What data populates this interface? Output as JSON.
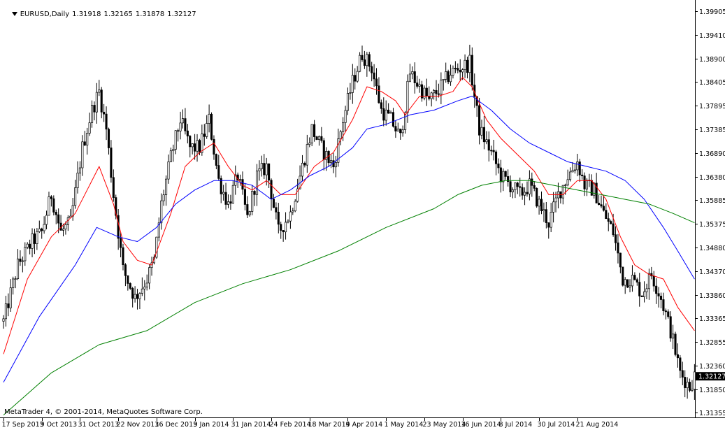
{
  "header": {
    "symbol": "EURUSD,Daily",
    "open": "1.31918",
    "high": "1.32165",
    "low": "1.31878",
    "close": "1.32127"
  },
  "copyright": "MetaTrader 4, © 2001-2014, MetaQuotes Software Corp.",
  "colors": {
    "background": "#ffffff",
    "candle": "#000000",
    "ma_short": "#ff0000",
    "ma_mid": "#0000ff",
    "ma_long": "#008000",
    "price_tag_bg": "#000000",
    "price_tag_fg": "#ffffff"
  },
  "chart_data": {
    "type": "candlestick",
    "symbol": "EURUSD",
    "timeframe": "Daily",
    "ylim": [
      1.3125,
      1.4015
    ],
    "y_ticks": [
      "1.39905",
      "1.39410",
      "1.38900",
      "1.38405",
      "1.37895",
      "1.37385",
      "1.36890",
      "1.36380",
      "1.35885",
      "1.35375",
      "1.34880",
      "1.34370",
      "1.33860",
      "1.33365",
      "1.32855",
      "1.32360",
      "1.31850",
      "1.31355"
    ],
    "current_price": "1.32127",
    "x_tick_labels": [
      "17 Sep 2013",
      "9 Oct 2013",
      "31 Oct 2013",
      "22 Nov 2013",
      "16 Dec 2013",
      "9 Jan 2014",
      "31 Jan 2014",
      "24 Feb 2014",
      "18 Mar 2014",
      "9 Apr 2014",
      "1 May 2014",
      "23 May 2014",
      "16 Jun 2014",
      "8 Jul 2014",
      "30 Jul 2014",
      "21 Aug 2014"
    ],
    "candles_per_label": 16,
    "close_path": [
      [
        0,
        1.333
      ],
      [
        6,
        1.345
      ],
      [
        12,
        1.35
      ],
      [
        16,
        1.352
      ],
      [
        20,
        1.36
      ],
      [
        24,
        1.352
      ],
      [
        28,
        1.354
      ],
      [
        33,
        1.37
      ],
      [
        37,
        1.378
      ],
      [
        40,
        1.382
      ],
      [
        43,
        1.374
      ],
      [
        46,
        1.36
      ],
      [
        50,
        1.344
      ],
      [
        55,
        1.338
      ],
      [
        60,
        1.342
      ],
      [
        63,
        1.346
      ],
      [
        66,
        1.358
      ],
      [
        70,
        1.368
      ],
      [
        74,
        1.376
      ],
      [
        78,
        1.37
      ],
      [
        82,
        1.37
      ],
      [
        86,
        1.376
      ],
      [
        90,
        1.363
      ],
      [
        94,
        1.358
      ],
      [
        98,
        1.364
      ],
      [
        102,
        1.355
      ],
      [
        106,
        1.364
      ],
      [
        110,
        1.366
      ],
      [
        115,
        1.352
      ],
      [
        120,
        1.356
      ],
      [
        124,
        1.364
      ],
      [
        129,
        1.374
      ],
      [
        134,
        1.369
      ],
      [
        138,
        1.366
      ],
      [
        142,
        1.376
      ],
      [
        146,
        1.384
      ],
      [
        150,
        1.39
      ],
      [
        154,
        1.387
      ],
      [
        158,
        1.378
      ],
      [
        162,
        1.376
      ],
      [
        166,
        1.372
      ],
      [
        170,
        1.386
      ],
      [
        174,
        1.383
      ],
      [
        178,
        1.38
      ],
      [
        183,
        1.383
      ],
      [
        187,
        1.386
      ],
      [
        191,
        1.387
      ],
      [
        195,
        1.388
      ],
      [
        199,
        1.374
      ],
      [
        204,
        1.369
      ],
      [
        208,
        1.364
      ],
      [
        212,
        1.362
      ],
      [
        216,
        1.36
      ],
      [
        220,
        1.362
      ],
      [
        224,
        1.358
      ],
      [
        228,
        1.354
      ],
      [
        232,
        1.36
      ],
      [
        236,
        1.364
      ],
      [
        240,
        1.367
      ],
      [
        243,
        1.362
      ],
      [
        247,
        1.361
      ],
      [
        251,
        1.356
      ],
      [
        255,
        1.352
      ],
      [
        259,
        1.342
      ],
      [
        263,
        1.342
      ],
      [
        267,
        1.339
      ],
      [
        271,
        1.343
      ],
      [
        275,
        1.338
      ],
      [
        279,
        1.331
      ],
      [
        283,
        1.322
      ],
      [
        287,
        1.319
      ],
      [
        289,
        1.3213
      ]
    ],
    "moving_averages": [
      {
        "color": "#ff0000",
        "points": [
          [
            0,
            1.326
          ],
          [
            10,
            1.342
          ],
          [
            20,
            1.351
          ],
          [
            30,
            1.356
          ],
          [
            40,
            1.366
          ],
          [
            46,
            1.358
          ],
          [
            50,
            1.35
          ],
          [
            56,
            1.346
          ],
          [
            62,
            1.345
          ],
          [
            70,
            1.356
          ],
          [
            76,
            1.366
          ],
          [
            82,
            1.369
          ],
          [
            88,
            1.371
          ],
          [
            94,
            1.366
          ],
          [
            100,
            1.362
          ],
          [
            104,
            1.361
          ],
          [
            110,
            1.363
          ],
          [
            116,
            1.36
          ],
          [
            122,
            1.36
          ],
          [
            130,
            1.366
          ],
          [
            138,
            1.369
          ],
          [
            146,
            1.376
          ],
          [
            152,
            1.383
          ],
          [
            158,
            1.382
          ],
          [
            164,
            1.38
          ],
          [
            168,
            1.377
          ],
          [
            174,
            1.381
          ],
          [
            182,
            1.381
          ],
          [
            188,
            1.382
          ],
          [
            192,
            1.385
          ],
          [
            196,
            1.383
          ],
          [
            202,
            1.376
          ],
          [
            208,
            1.372
          ],
          [
            214,
            1.369
          ],
          [
            218,
            1.367
          ],
          [
            222,
            1.365
          ],
          [
            228,
            1.36
          ],
          [
            234,
            1.36
          ],
          [
            240,
            1.363
          ],
          [
            246,
            1.363
          ],
          [
            252,
            1.359
          ],
          [
            258,
            1.351
          ],
          [
            264,
            1.345
          ],
          [
            270,
            1.343
          ],
          [
            276,
            1.342
          ],
          [
            282,
            1.336
          ],
          [
            289,
            1.331
          ]
        ]
      },
      {
        "color": "#0000ff",
        "points": [
          [
            0,
            1.32
          ],
          [
            15,
            1.334
          ],
          [
            30,
            1.345
          ],
          [
            39,
            1.353
          ],
          [
            48,
            1.351
          ],
          [
            56,
            1.35
          ],
          [
            64,
            1.353
          ],
          [
            72,
            1.358
          ],
          [
            80,
            1.361
          ],
          [
            88,
            1.363
          ],
          [
            96,
            1.363
          ],
          [
            104,
            1.362
          ],
          [
            112,
            1.359
          ],
          [
            120,
            1.361
          ],
          [
            128,
            1.364
          ],
          [
            136,
            1.366
          ],
          [
            146,
            1.37
          ],
          [
            152,
            1.374
          ],
          [
            160,
            1.375
          ],
          [
            170,
            1.377
          ],
          [
            180,
            1.378
          ],
          [
            190,
            1.38
          ],
          [
            196,
            1.381
          ],
          [
            204,
            1.378
          ],
          [
            212,
            1.374
          ],
          [
            220,
            1.371
          ],
          [
            228,
            1.369
          ],
          [
            236,
            1.367
          ],
          [
            244,
            1.366
          ],
          [
            252,
            1.365
          ],
          [
            260,
            1.363
          ],
          [
            268,
            1.359
          ],
          [
            276,
            1.353
          ],
          [
            282,
            1.348
          ],
          [
            289,
            1.342
          ]
        ]
      },
      {
        "color": "#008000",
        "points": [
          [
            0,
            1.313
          ],
          [
            20,
            1.322
          ],
          [
            40,
            1.328
          ],
          [
            60,
            1.331
          ],
          [
            80,
            1.337
          ],
          [
            100,
            1.341
          ],
          [
            120,
            1.344
          ],
          [
            140,
            1.348
          ],
          [
            160,
            1.353
          ],
          [
            180,
            1.357
          ],
          [
            190,
            1.36
          ],
          [
            200,
            1.362
          ],
          [
            210,
            1.363
          ],
          [
            220,
            1.363
          ],
          [
            230,
            1.362
          ],
          [
            240,
            1.361
          ],
          [
            250,
            1.36
          ],
          [
            260,
            1.359
          ],
          [
            270,
            1.358
          ],
          [
            280,
            1.356
          ],
          [
            289,
            1.354
          ]
        ]
      }
    ]
  }
}
